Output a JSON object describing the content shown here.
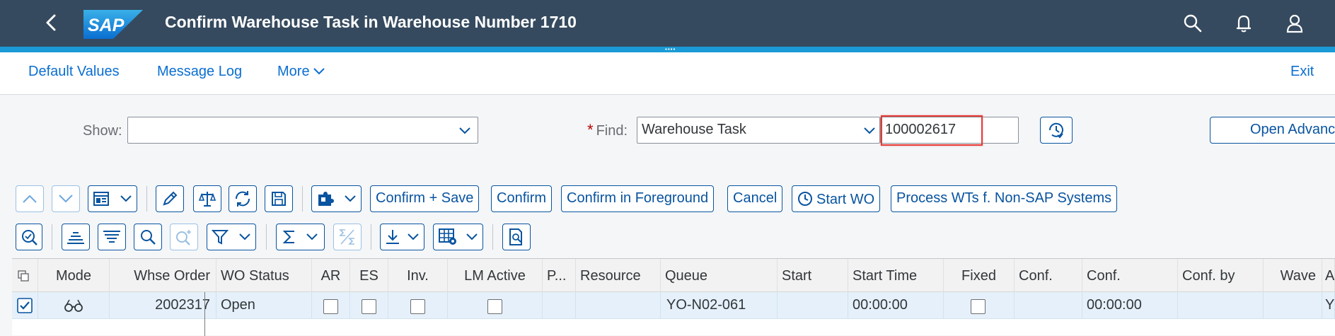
{
  "shell": {
    "title": "Confirm Warehouse Task in Warehouse Number 1710",
    "logo_text": "SAP",
    "icons": [
      "back-icon",
      "search-icon",
      "bell-icon",
      "user-icon"
    ],
    "colors": {
      "shell": "#354a5f",
      "accent": "#1a9ad6",
      "link": "#0a6ed1"
    }
  },
  "menu": {
    "default_values": "Default Values",
    "message_log": "Message Log",
    "more": "More",
    "exit": "Exit"
  },
  "filter": {
    "show_label": "Show:",
    "show_value": "",
    "find_required": "*",
    "find_label": "Find:",
    "find_type": "Warehouse Task",
    "find_value": "100002617",
    "open_advanced": "Open Advanc"
  },
  "toolbar": {
    "confirm_save": "Confirm + Save",
    "confirm": "Confirm",
    "confirm_foreground": "Confirm in Foreground",
    "cancel": "Cancel",
    "start_wo": "Start WO",
    "process_wts": "Process WTs f. Non-SAP Systems"
  },
  "table": {
    "headers": {
      "mode": "Mode",
      "whse_order": "Whse Order",
      "wo_status": "WO Status",
      "ar": "AR",
      "es": "ES",
      "inv": "Inv.",
      "lm_active": "LM Active",
      "p": "P...",
      "resource": "Resource",
      "queue": "Queue",
      "start": "Start",
      "start_time": "Start Time",
      "fixed": "Fixed",
      "conf1": "Conf.",
      "conf2": "Conf.",
      "conf_by": "Conf. by",
      "wave": "Wave",
      "act": "Act"
    },
    "row": {
      "selected": true,
      "whse_order": "2002317",
      "wo_status": "Open",
      "queue": "YO-N02-061",
      "start_time": "00:00:00",
      "conf_time": "00:00:00",
      "act": "YN"
    }
  }
}
